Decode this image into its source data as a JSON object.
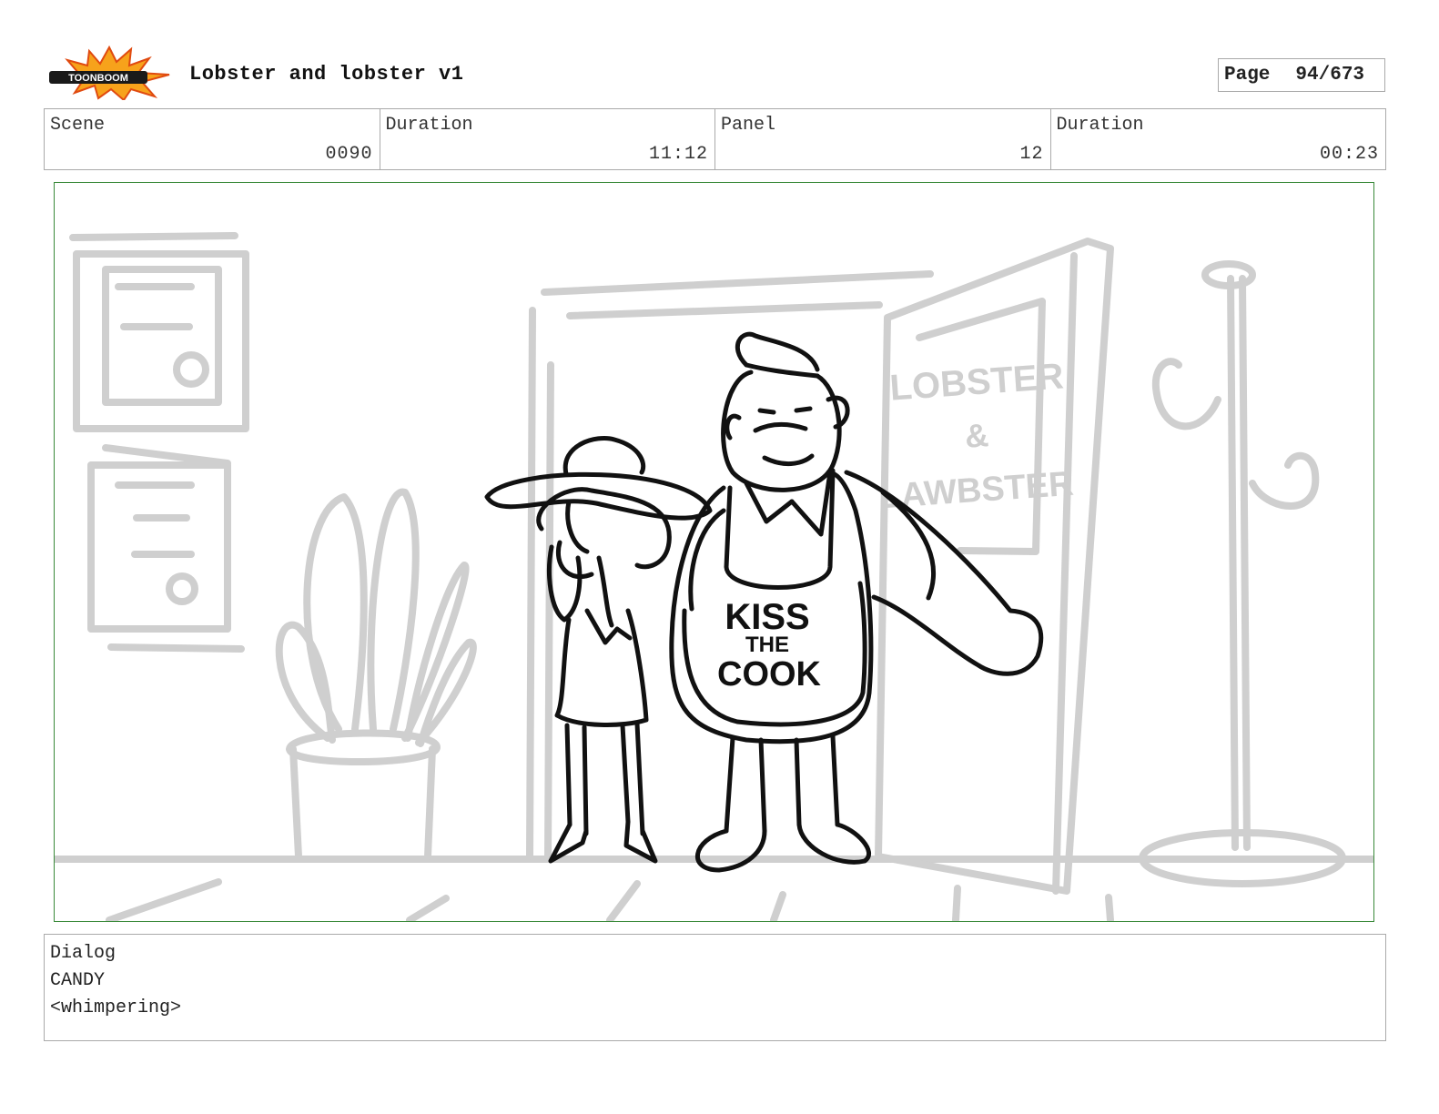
{
  "header": {
    "logo_text": "TOONBOOM",
    "title": "Lobster and lobster v1",
    "page_label": "Page",
    "page_value": "94/673"
  },
  "info": {
    "scene_label": "Scene",
    "scene_value": "0090",
    "duration_label": "Duration",
    "duration_value": "11:12",
    "panel_label": "Panel",
    "panel_value": "12",
    "panel_duration_label": "Duration",
    "panel_duration_value": "00:23"
  },
  "panel_art": {
    "door_sign": [
      "LOBSTER",
      "&",
      "LAWBSTER"
    ],
    "apron_text": [
      "KISS",
      "THE",
      "COOK"
    ]
  },
  "dialog": {
    "label": "Dialog",
    "character": "CANDY",
    "line": "<whimpering>"
  }
}
